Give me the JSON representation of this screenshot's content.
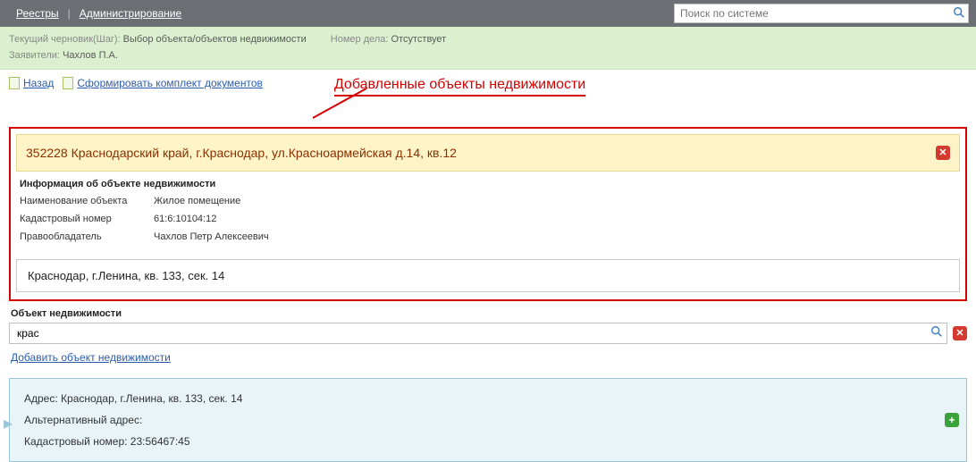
{
  "topnav": {
    "registries": "Реестры",
    "admin": "Администрирование",
    "search_placeholder": "Поиск по системе"
  },
  "infostrip": {
    "draft_label": "Текущий черновик(Шаг):",
    "draft_value": "Выбор объекта/объектов недвижимости",
    "case_label": "Номер дела:",
    "case_value": "Отсутствует",
    "applicant_label": "Заявители:",
    "applicant_value": "Чахлов П.А."
  },
  "actions": {
    "back": "Назад",
    "build_docs": "Сформировать комплект документов"
  },
  "callout": "Добавленные объекты недвижимости",
  "object": {
    "title": "352228 Краснодарский край, г.Краснодар, ул.Красноармейская д.14, кв.12",
    "section_title": "Информация об объекте недвижимости",
    "name_label": "Наименование объекта",
    "name_value": "Жилое помещение",
    "cadastral_label": "Кадастровый номер",
    "cadastral_value": "61:6:10104:12",
    "owner_label": "Правообладатель",
    "owner_value": "Чахлов Петр Алексеевич",
    "second_address": "Краснодар, г.Ленина, кв. 133, сек. 14"
  },
  "lower": {
    "section_title": "Объект недвижимости",
    "query": "крас",
    "add_link": "Добавить объект недвижимости"
  },
  "suggestion": {
    "address_label": "Адрес:",
    "address_value": "Краснодар, г.Ленина, кв. 133, сек. 14",
    "alt_label": "Альтернативный адрес:",
    "alt_value": "",
    "cad_label": "Кадастровый номер:",
    "cad_value": "23:56467:45"
  }
}
